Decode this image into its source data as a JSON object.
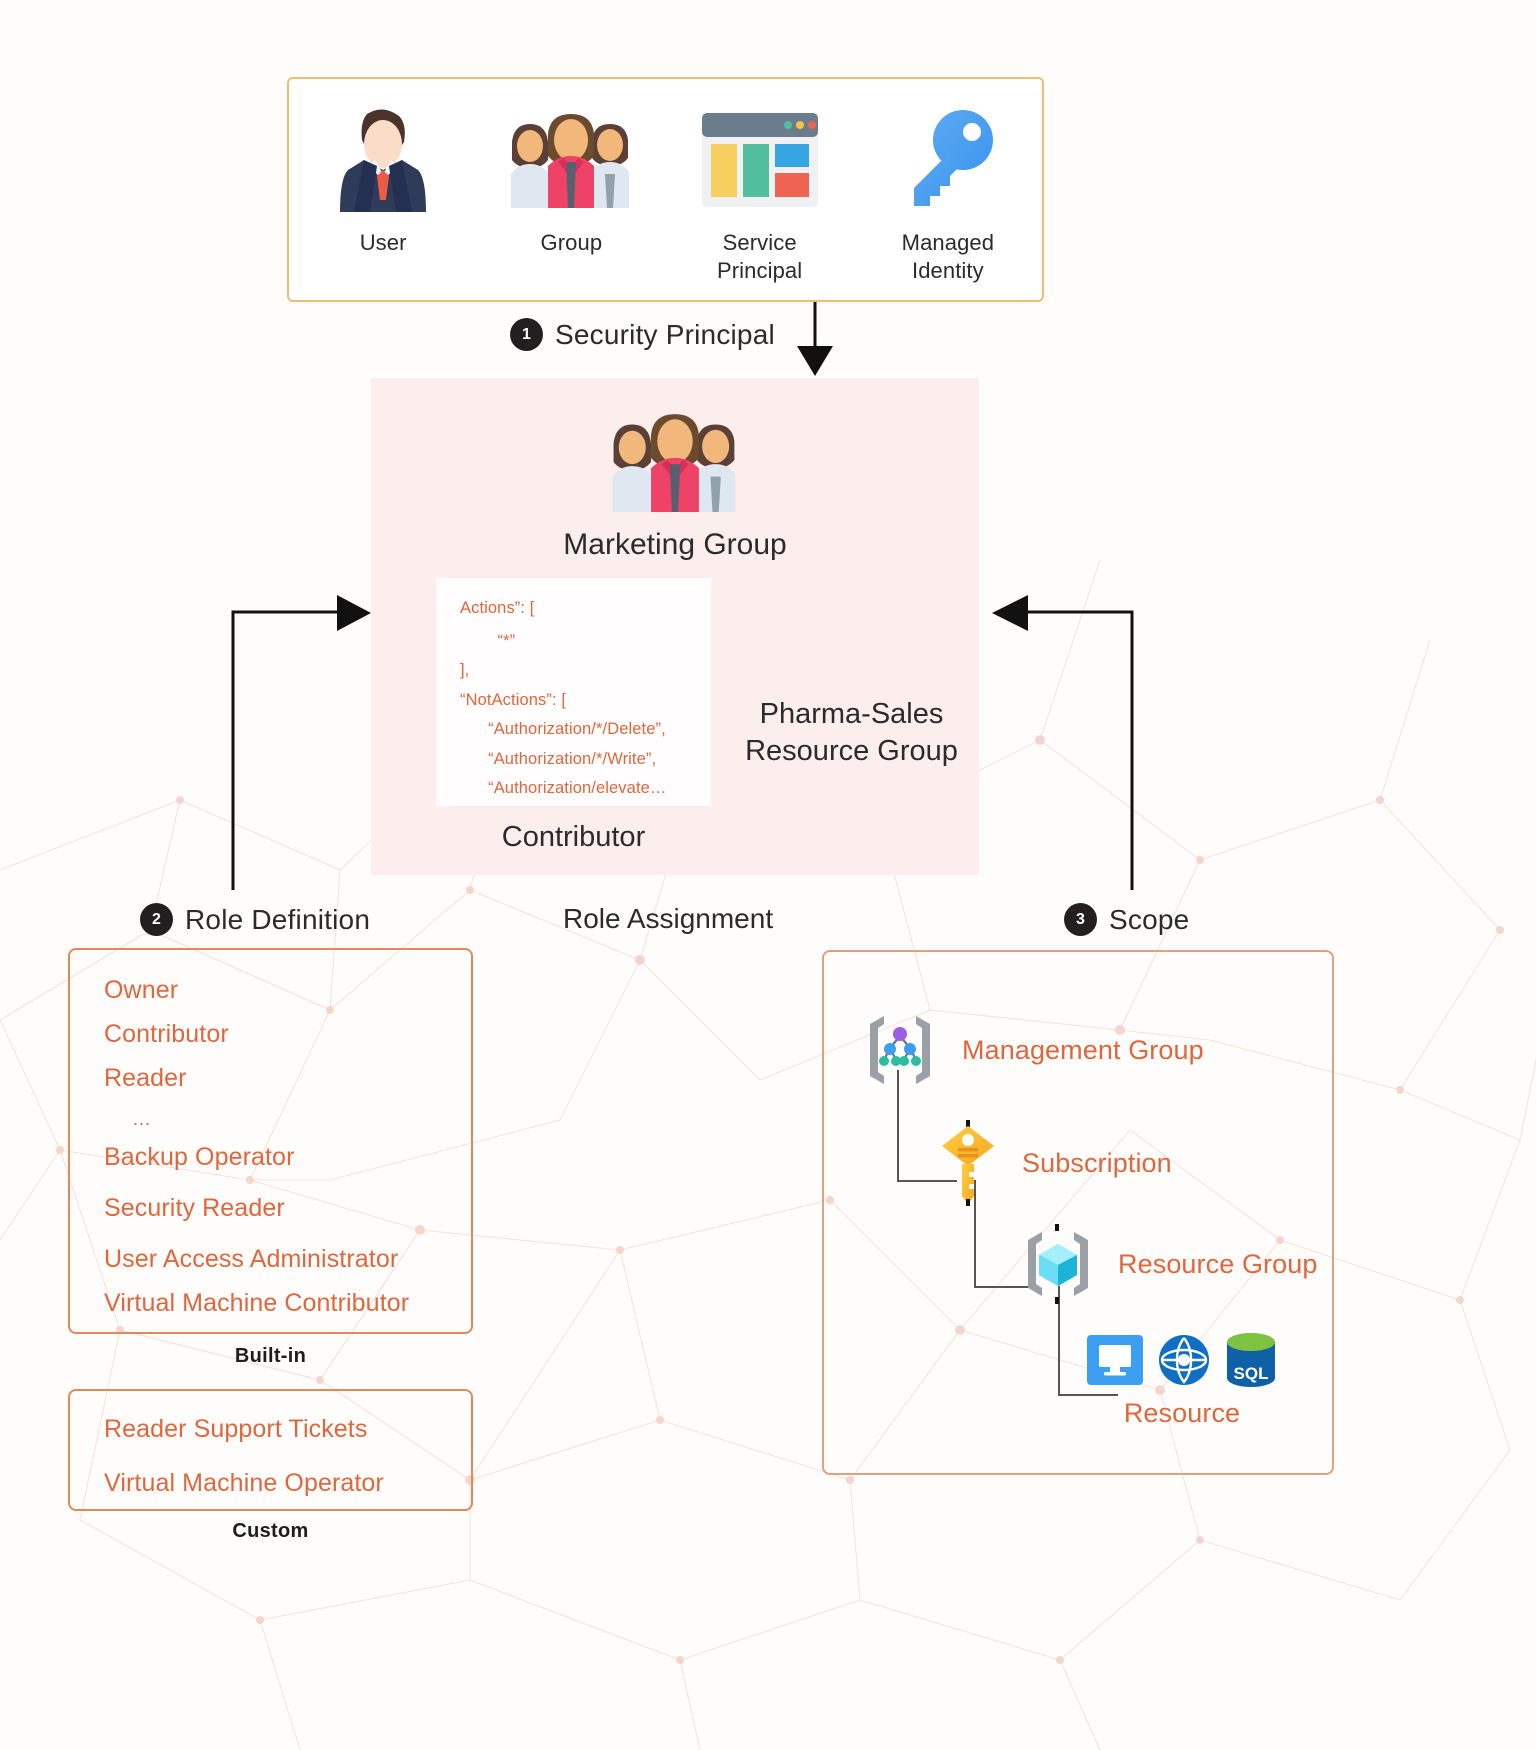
{
  "principals_panel": {
    "border_color": "#edbe72",
    "items": [
      {
        "icon": "user-avatar-icon",
        "label": "User"
      },
      {
        "icon": "group-people-icon",
        "label": "Group"
      },
      {
        "icon": "service-principal-icon",
        "label": "Service\nPrincipal"
      },
      {
        "icon": "managed-identity-key-icon",
        "label": "Managed\nIdentity"
      }
    ]
  },
  "steps": {
    "security_principal": {
      "number": "1",
      "text": "Security Principal"
    },
    "role_definition": {
      "number": "2",
      "text": "Role Definition"
    },
    "scope": {
      "number": "3",
      "text": "Scope"
    }
  },
  "role_assignment": {
    "caption": "Role Assignment",
    "card_bg": "#fceeec",
    "group_icon": "group-people-icon",
    "group_label": "Marketing Group",
    "role_label": "Contributor",
    "scope_label": "Pharma-Sales\nResource Group",
    "code": {
      "text_color": "#e0663c",
      "lines": [
        "Actions”: [",
        "        “*”",
        "],",
        "“NotActions”: [",
        "      “Authorization/*/Delete”,",
        "      “Authorization/*/Write”,",
        "      “Authorization/elevate…"
      ]
    }
  },
  "role_definition": {
    "accent_color": "#e0663c",
    "builtin": {
      "caption": "Built-in",
      "items": [
        "Owner",
        "Contributor",
        "Reader",
        "…",
        "Backup Operator",
        "Security Reader",
        "User Access Administrator",
        "Virtual Machine Contributor"
      ]
    },
    "custom": {
      "caption": "Custom",
      "items": [
        "Reader Support Tickets",
        "Virtual Machine Operator"
      ]
    }
  },
  "scope": {
    "accent_color": "#e0663c",
    "levels": [
      {
        "icon": "management-group-icon",
        "label": "Management Group"
      },
      {
        "icon": "subscription-key-icon",
        "label": "Subscription"
      },
      {
        "icon": "resource-group-icon",
        "label": "Resource Group"
      },
      {
        "icon": "resource-icons",
        "label": "Resource"
      }
    ]
  }
}
